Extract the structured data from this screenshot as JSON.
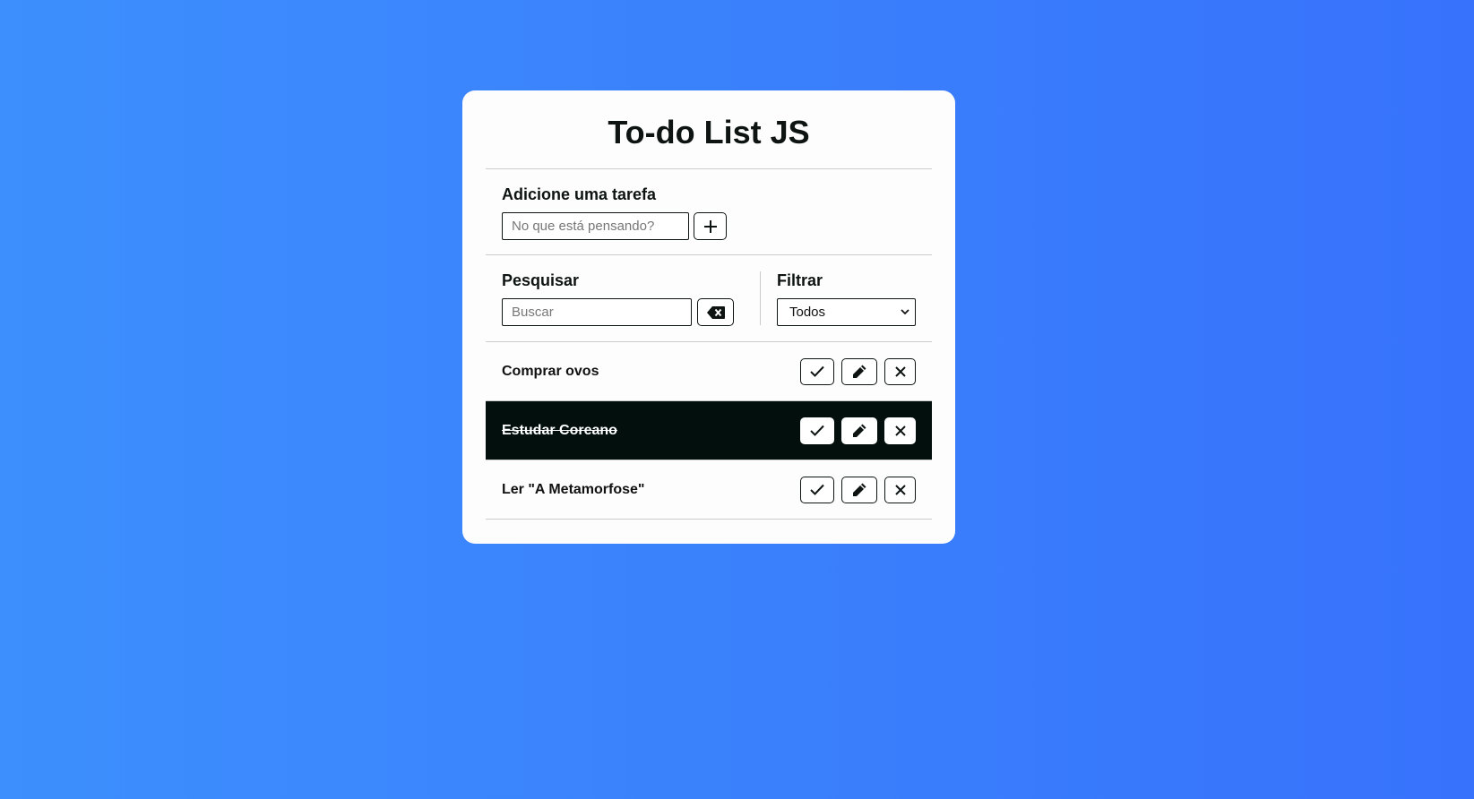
{
  "app": {
    "title": "To-do List JS"
  },
  "add": {
    "label": "Adicione uma tarefa",
    "placeholder": "No que está pensando?",
    "button_icon": "plus-icon"
  },
  "search": {
    "label": "Pesquisar",
    "placeholder": "Buscar",
    "clear_icon": "backspace-icon"
  },
  "filter": {
    "label": "Filtrar",
    "selected": "Todos"
  },
  "todos": [
    {
      "text": "Comprar ovos",
      "done": false
    },
    {
      "text": "Estudar Coreano",
      "done": true
    },
    {
      "text": "Ler \"A Metamorfose\"",
      "done": false
    }
  ],
  "colors": {
    "background_start": "#3d8ffd",
    "background_end": "#3772fc",
    "card": "#fdfdfd",
    "done_row": "#020f0d"
  }
}
